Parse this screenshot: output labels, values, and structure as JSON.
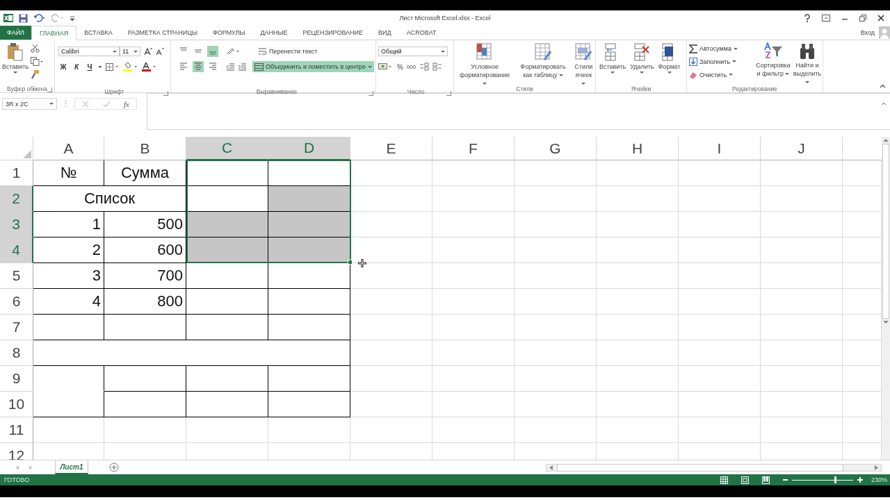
{
  "window": {
    "title": "Лист Microsoft Excel.xlsx - Excel"
  },
  "tabs": [
    {
      "label": "ФАЙЛ",
      "kind": "file",
      "selected": false
    },
    {
      "label": "ГЛАВНАЯ",
      "kind": "tab",
      "selected": true
    },
    {
      "label": "ВСТАВКА",
      "kind": "tab",
      "selected": false
    },
    {
      "label": "РАЗМЕТКА СТРАНИЦЫ",
      "kind": "tab",
      "selected": false
    },
    {
      "label": "ФОРМУЛЫ",
      "kind": "tab",
      "selected": false
    },
    {
      "label": "ДАННЫЕ",
      "kind": "tab",
      "selected": false
    },
    {
      "label": "РЕЦЕНЗИРОВАНИЕ",
      "kind": "tab",
      "selected": false
    },
    {
      "label": "ВИД",
      "kind": "tab",
      "selected": false
    },
    {
      "label": "ACROBAT",
      "kind": "tab",
      "selected": false
    }
  ],
  "account": {
    "label": "Вход"
  },
  "ribbon": {
    "clipboard": {
      "label": "Буфер обмена",
      "paste": "Вставить"
    },
    "font": {
      "label": "Шрифт",
      "name": "Calibri",
      "size": "11",
      "bold": "Ж",
      "italic": "К",
      "underline": "Ч"
    },
    "alignment": {
      "label": "Выравнивание",
      "wrap_text": "Перенести текст",
      "merge": {
        "label": "Объединить и поместить в центре",
        "selected": true
      },
      "vertical": [
        {
          "selected": false
        },
        {
          "selected": false
        },
        {
          "selected": true
        }
      ],
      "horizontal": [
        {
          "selected": false
        },
        {
          "selected": true
        },
        {
          "selected": false
        }
      ]
    },
    "number": {
      "label": "Число",
      "format": "Общий",
      "percent": "%",
      "thousands": "000"
    },
    "styles": {
      "label": "Стили",
      "buttons": [
        "Условное форматирование",
        "Форматировать как таблицу",
        "Стили ячеек"
      ]
    },
    "cells": {
      "label": "Ячейки",
      "buttons": [
        "Вставить",
        "Удалить",
        "Формат"
      ]
    },
    "editing": {
      "label": "Редактирование",
      "autosum": "Автосумма",
      "fill": "Заполнить",
      "clear": "Очистить",
      "buttons": [
        "Сортировка и фильтр",
        "Найти и выделить"
      ]
    }
  },
  "formula_bar": {
    "name_box": "3R x 2C",
    "function_button": "fx"
  },
  "columns": [
    {
      "label": "A",
      "selected": false
    },
    {
      "label": "B",
      "selected": false
    },
    {
      "label": "C",
      "selected": true
    },
    {
      "label": "D",
      "selected": true
    },
    {
      "label": "E",
      "selected": false
    },
    {
      "label": "F",
      "selected": false
    },
    {
      "label": "G",
      "selected": false
    },
    {
      "label": "H",
      "selected": false
    },
    {
      "label": "I",
      "selected": false
    },
    {
      "label": "J",
      "selected": false
    }
  ],
  "rows": [
    {
      "number": "1",
      "kind": "titles",
      "selected": false,
      "cells": [
        "№",
        "Сумма"
      ]
    },
    {
      "number": "2",
      "kind": "merged",
      "selected": true,
      "cells": [
        "Список"
      ]
    },
    {
      "number": "3",
      "kind": "values",
      "selected": true,
      "cells": [
        "1",
        "500"
      ]
    },
    {
      "number": "4",
      "kind": "values",
      "selected": true,
      "cells": [
        "2",
        "600"
      ]
    },
    {
      "number": "5",
      "kind": "values",
      "selected": false,
      "cells": [
        "3",
        "700"
      ]
    },
    {
      "number": "6",
      "kind": "values",
      "selected": false,
      "cells": [
        "4",
        "800"
      ]
    },
    {
      "number": "7",
      "kind": "blank",
      "selected": false
    },
    {
      "number": "8",
      "kind": "wide",
      "selected": false
    },
    {
      "number": "9",
      "kind": "split-top",
      "selected": false
    },
    {
      "number": "10",
      "kind": "split-bottom",
      "selected": false
    },
    {
      "number": "11",
      "kind": "empty",
      "selected": false
    },
    {
      "number": "12",
      "kind": "empty",
      "selected": false
    }
  ],
  "sheet_tabs": [
    {
      "label": "Лист1",
      "selected": true
    }
  ],
  "status": {
    "text": "ГОТОВО",
    "zoom": "230%",
    "zoom_slider": {
      "level": 0.7
    }
  }
}
